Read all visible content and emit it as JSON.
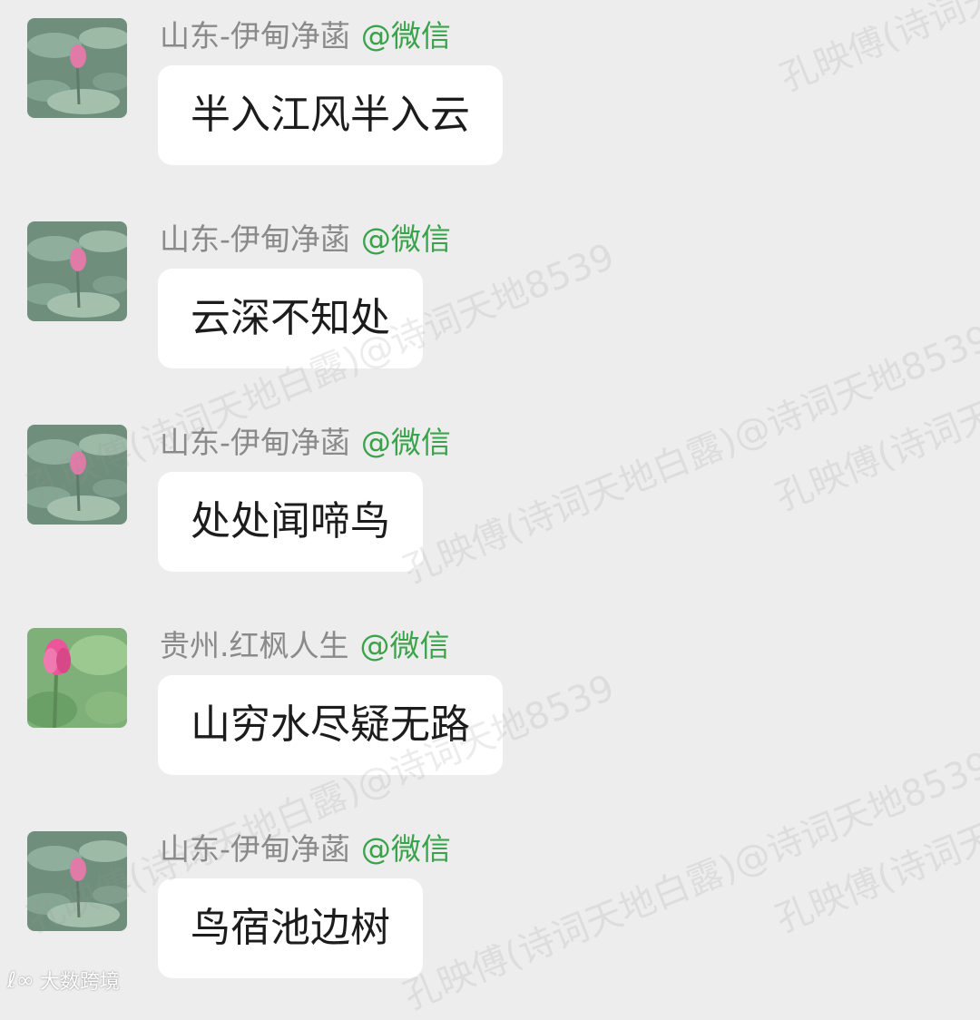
{
  "messages": [
    {
      "sender": "山东-伊甸净菡",
      "source": "@微信",
      "text": "半入江风半入云",
      "avatar": "lotus-bud-icon"
    },
    {
      "sender": "山东-伊甸净菡",
      "source": "@微信",
      "text": "云深不知处",
      "avatar": "lotus-bud-icon"
    },
    {
      "sender": "山东-伊甸净菡",
      "source": "@微信",
      "text": "处处闻啼鸟",
      "avatar": "lotus-bud-icon"
    },
    {
      "sender": "贵州.红枫人生",
      "source": "@微信",
      "text": "山穷水尽疑无路",
      "avatar": "pink-lotus-icon"
    },
    {
      "sender": "山东-伊甸净菡",
      "source": "@微信",
      "text": "鸟宿池边树",
      "avatar": "lotus-bud-icon"
    }
  ],
  "watermarks": [
    "孔映傅(诗词天",
    "孔映傅(诗词天地白露)@诗词天地8539",
    "孔映傅(诗词天地白露)@诗词天地8539",
    "孔映傅(诗词天地",
    "孔映傅(诗词天地白露)@诗词天地8539",
    "孔映傅(诗词天地白露)@诗词天地8539",
    "孔映傅(诗词天地"
  ],
  "corner_logo": {
    "glyph": "ℓ∞",
    "text": "大数跨境"
  },
  "colors": {
    "background": "#ededed",
    "bubble": "#ffffff",
    "sender": "#8a8a8a",
    "source": "#3aa34a"
  }
}
